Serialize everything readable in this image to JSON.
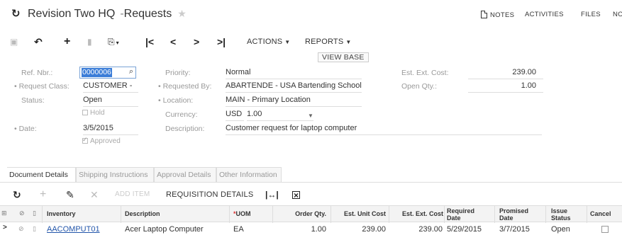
{
  "title": {
    "app": "Revision Two HQ",
    "page": "Requests",
    "separator": "-"
  },
  "title_actions": {
    "notes": "NOTES",
    "activities": "ACTIVITIES",
    "files": "FILES",
    "more": "NO"
  },
  "toolbar": {
    "actions": "ACTIONS",
    "reports": "REPORTS"
  },
  "form": {
    "ref_nbr_label": "Ref. Nbr.:",
    "ref_nbr_value": "0000006",
    "request_class_label": "Request Class:",
    "request_class_value": "CUSTOMER -",
    "status_label": "Status:",
    "status_value": "Open",
    "hold_label": "Hold",
    "date_label": "Date:",
    "date_value": "3/5/2015",
    "approved_label": "Approved",
    "priority_label": "Priority:",
    "priority_value": "Normal",
    "requested_by_label": "Requested By:",
    "requested_by_value": "ABARTENDE - USA Bartending School",
    "location_label": "Location:",
    "location_value": "MAIN - Primary Location",
    "currency_label": "Currency:",
    "currency_value": "USD",
    "rate_value": "1.00",
    "view_base": "VIEW BASE",
    "description_label": "Description:",
    "description_value": "Customer request for laptop computer",
    "est_ext_cost_label": "Est. Ext. Cost:",
    "est_ext_cost_value": "239.00",
    "open_qty_label": "Open Qty.:",
    "open_qty_value": "1.00"
  },
  "tabs": [
    {
      "label": "Document Details"
    },
    {
      "label": "Shipping Instructions"
    },
    {
      "label": "Approval Details"
    },
    {
      "label": "Other Information"
    }
  ],
  "grid_toolbar": {
    "add_item": "ADD ITEM",
    "requisition_details": "REQUISITION DETAILS"
  },
  "grid": {
    "headers": {
      "inventory": "Inventory",
      "description": "Description",
      "uom": "UOM",
      "order_qty": "Order Qty.",
      "est_unit_cost": "Est. Unit Cost",
      "est_ext_cost": "Est. Ext. Cost",
      "required_date": "Required Date",
      "promised_date": "Promised Date",
      "issue_status": "Issue Status",
      "cancel": "Cancel"
    },
    "rows": [
      {
        "inventory": "AACOMPUT01",
        "description": "Acer Laptop Computer",
        "uom": "EA",
        "order_qty": "1.00",
        "est_unit_cost": "239.00",
        "est_ext_cost": "239.00",
        "required_date": "5/29/2015",
        "promised_date": "3/7/2015",
        "issue_status": "Open"
      }
    ]
  }
}
